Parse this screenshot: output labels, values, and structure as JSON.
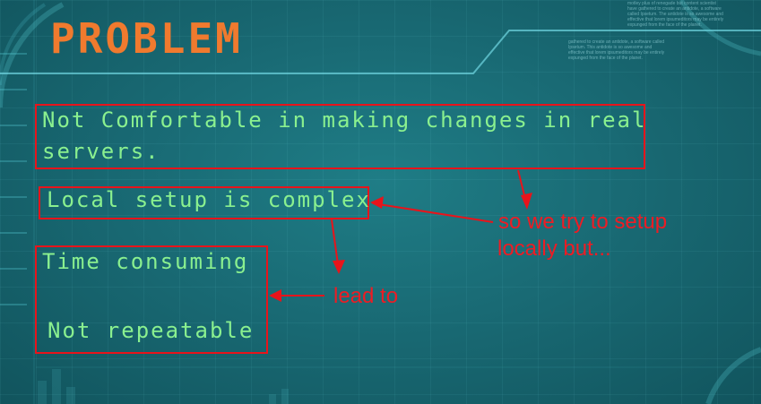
{
  "slide": {
    "title": "PROBLEM",
    "fine_print_top": "motley plus of renegade but content scientist have gathered to create an antidote, a software called Ipsetum. The antidote is so awesome and effective that lorem ipsumeditors may be entirely expunged from the face of the planet.",
    "fine_print_mid": "gathered to create an antidote, a software called Ipsetum. This antidote is so awesome and effective that lorem ipsumeditors may be entirely expunged from the face of the planet.",
    "points": {
      "line1": "Not Comfortable in making changes in real",
      "line2": "servers.",
      "local": "Local setup is complex",
      "time": "Time consuming",
      "repeat": "Not repeatable"
    },
    "annotations": {
      "setup_line1": "so we try to setup",
      "setup_line2": "locally but...",
      "lead": "lead to"
    },
    "colors": {
      "background": "#196a74",
      "title": "#f07a2e",
      "text": "#8af08f",
      "annotation": "#ee1c24"
    }
  }
}
